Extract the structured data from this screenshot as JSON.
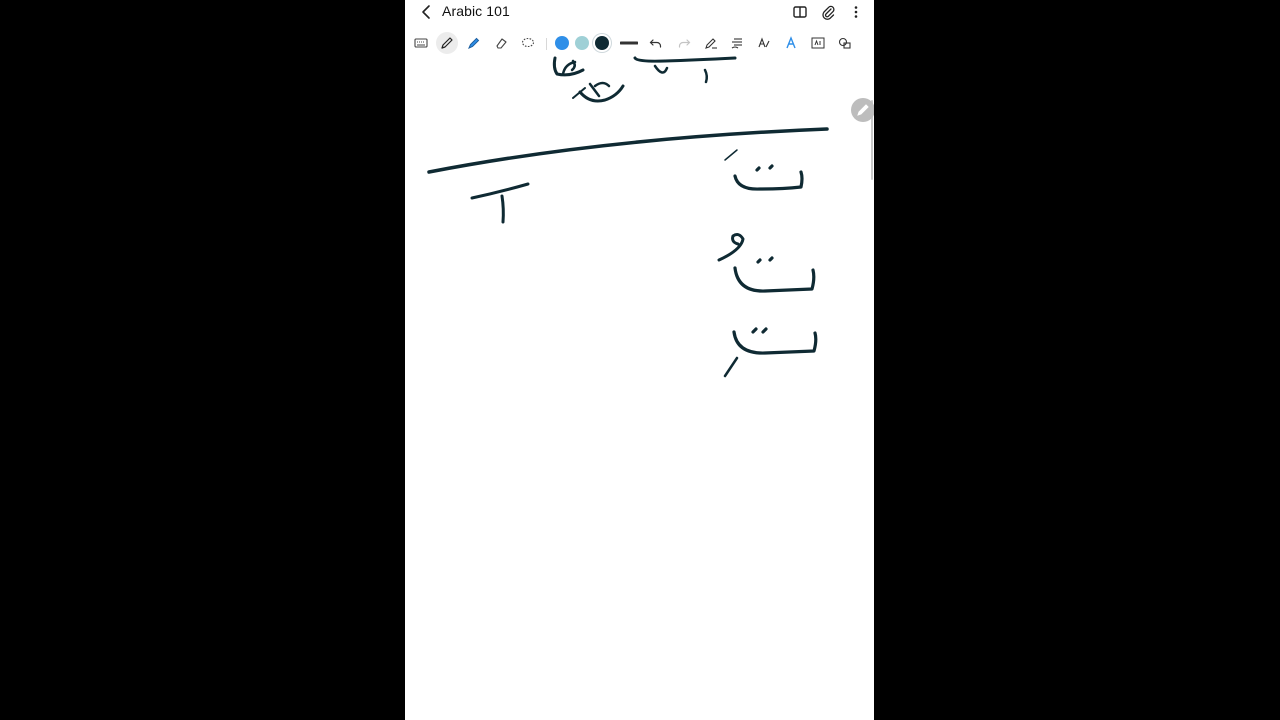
{
  "app": {
    "title": "Arabic 101"
  },
  "header_icons": [
    "back-arrow-icon",
    "book-view-icon",
    "paperclip-icon",
    "more-vert-icon"
  ],
  "toolbar": {
    "tools": [
      "keyboard-icon",
      "pen-icon",
      "highlighter-icon",
      "eraser-icon",
      "lasso-icon"
    ],
    "active_tool": "pen-icon",
    "colors": [
      "#2f8fe8",
      "#9fd0d6",
      "#0f2a33"
    ],
    "selected_color": "#0f2a33",
    "right_tools": [
      "stroke-width-icon",
      "undo-icon",
      "redo-icon",
      "pen-settings-icon",
      "text-format-icon",
      "handwriting-to-text-icon",
      "text-style-icon",
      "text-box-icon",
      "shapes-icon"
    ]
  },
  "canvas": {
    "ink_color": "#0f2a33"
  }
}
